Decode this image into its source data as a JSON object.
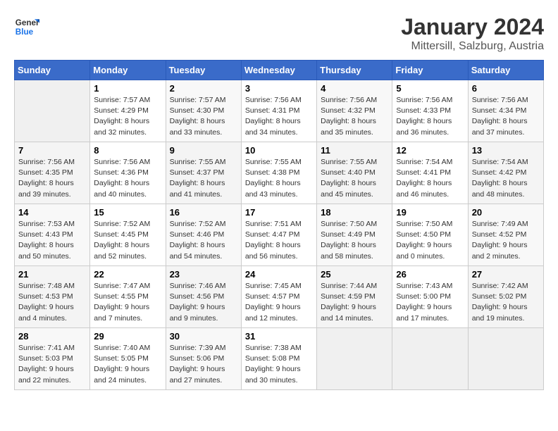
{
  "logo": {
    "line1": "General",
    "line2": "Blue"
  },
  "title": "January 2024",
  "subtitle": "Mittersill, Salzburg, Austria",
  "headers": [
    "Sunday",
    "Monday",
    "Tuesday",
    "Wednesday",
    "Thursday",
    "Friday",
    "Saturday"
  ],
  "weeks": [
    [
      {
        "day": "",
        "info": ""
      },
      {
        "day": "1",
        "info": "Sunrise: 7:57 AM\nSunset: 4:29 PM\nDaylight: 8 hours\nand 32 minutes."
      },
      {
        "day": "2",
        "info": "Sunrise: 7:57 AM\nSunset: 4:30 PM\nDaylight: 8 hours\nand 33 minutes."
      },
      {
        "day": "3",
        "info": "Sunrise: 7:56 AM\nSunset: 4:31 PM\nDaylight: 8 hours\nand 34 minutes."
      },
      {
        "day": "4",
        "info": "Sunrise: 7:56 AM\nSunset: 4:32 PM\nDaylight: 8 hours\nand 35 minutes."
      },
      {
        "day": "5",
        "info": "Sunrise: 7:56 AM\nSunset: 4:33 PM\nDaylight: 8 hours\nand 36 minutes."
      },
      {
        "day": "6",
        "info": "Sunrise: 7:56 AM\nSunset: 4:34 PM\nDaylight: 8 hours\nand 37 minutes."
      }
    ],
    [
      {
        "day": "7",
        "info": "Sunrise: 7:56 AM\nSunset: 4:35 PM\nDaylight: 8 hours\nand 39 minutes."
      },
      {
        "day": "8",
        "info": "Sunrise: 7:56 AM\nSunset: 4:36 PM\nDaylight: 8 hours\nand 40 minutes."
      },
      {
        "day": "9",
        "info": "Sunrise: 7:55 AM\nSunset: 4:37 PM\nDaylight: 8 hours\nand 41 minutes."
      },
      {
        "day": "10",
        "info": "Sunrise: 7:55 AM\nSunset: 4:38 PM\nDaylight: 8 hours\nand 43 minutes."
      },
      {
        "day": "11",
        "info": "Sunrise: 7:55 AM\nSunset: 4:40 PM\nDaylight: 8 hours\nand 45 minutes."
      },
      {
        "day": "12",
        "info": "Sunrise: 7:54 AM\nSunset: 4:41 PM\nDaylight: 8 hours\nand 46 minutes."
      },
      {
        "day": "13",
        "info": "Sunrise: 7:54 AM\nSunset: 4:42 PM\nDaylight: 8 hours\nand 48 minutes."
      }
    ],
    [
      {
        "day": "14",
        "info": "Sunrise: 7:53 AM\nSunset: 4:43 PM\nDaylight: 8 hours\nand 50 minutes."
      },
      {
        "day": "15",
        "info": "Sunrise: 7:52 AM\nSunset: 4:45 PM\nDaylight: 8 hours\nand 52 minutes."
      },
      {
        "day": "16",
        "info": "Sunrise: 7:52 AM\nSunset: 4:46 PM\nDaylight: 8 hours\nand 54 minutes."
      },
      {
        "day": "17",
        "info": "Sunrise: 7:51 AM\nSunset: 4:47 PM\nDaylight: 8 hours\nand 56 minutes."
      },
      {
        "day": "18",
        "info": "Sunrise: 7:50 AM\nSunset: 4:49 PM\nDaylight: 8 hours\nand 58 minutes."
      },
      {
        "day": "19",
        "info": "Sunrise: 7:50 AM\nSunset: 4:50 PM\nDaylight: 9 hours\nand 0 minutes."
      },
      {
        "day": "20",
        "info": "Sunrise: 7:49 AM\nSunset: 4:52 PM\nDaylight: 9 hours\nand 2 minutes."
      }
    ],
    [
      {
        "day": "21",
        "info": "Sunrise: 7:48 AM\nSunset: 4:53 PM\nDaylight: 9 hours\nand 4 minutes."
      },
      {
        "day": "22",
        "info": "Sunrise: 7:47 AM\nSunset: 4:55 PM\nDaylight: 9 hours\nand 7 minutes."
      },
      {
        "day": "23",
        "info": "Sunrise: 7:46 AM\nSunset: 4:56 PM\nDaylight: 9 hours\nand 9 minutes."
      },
      {
        "day": "24",
        "info": "Sunrise: 7:45 AM\nSunset: 4:57 PM\nDaylight: 9 hours\nand 12 minutes."
      },
      {
        "day": "25",
        "info": "Sunrise: 7:44 AM\nSunset: 4:59 PM\nDaylight: 9 hours\nand 14 minutes."
      },
      {
        "day": "26",
        "info": "Sunrise: 7:43 AM\nSunset: 5:00 PM\nDaylight: 9 hours\nand 17 minutes."
      },
      {
        "day": "27",
        "info": "Sunrise: 7:42 AM\nSunset: 5:02 PM\nDaylight: 9 hours\nand 19 minutes."
      }
    ],
    [
      {
        "day": "28",
        "info": "Sunrise: 7:41 AM\nSunset: 5:03 PM\nDaylight: 9 hours\nand 22 minutes."
      },
      {
        "day": "29",
        "info": "Sunrise: 7:40 AM\nSunset: 5:05 PM\nDaylight: 9 hours\nand 24 minutes."
      },
      {
        "day": "30",
        "info": "Sunrise: 7:39 AM\nSunset: 5:06 PM\nDaylight: 9 hours\nand 27 minutes."
      },
      {
        "day": "31",
        "info": "Sunrise: 7:38 AM\nSunset: 5:08 PM\nDaylight: 9 hours\nand 30 minutes."
      },
      {
        "day": "",
        "info": ""
      },
      {
        "day": "",
        "info": ""
      },
      {
        "day": "",
        "info": ""
      }
    ]
  ]
}
